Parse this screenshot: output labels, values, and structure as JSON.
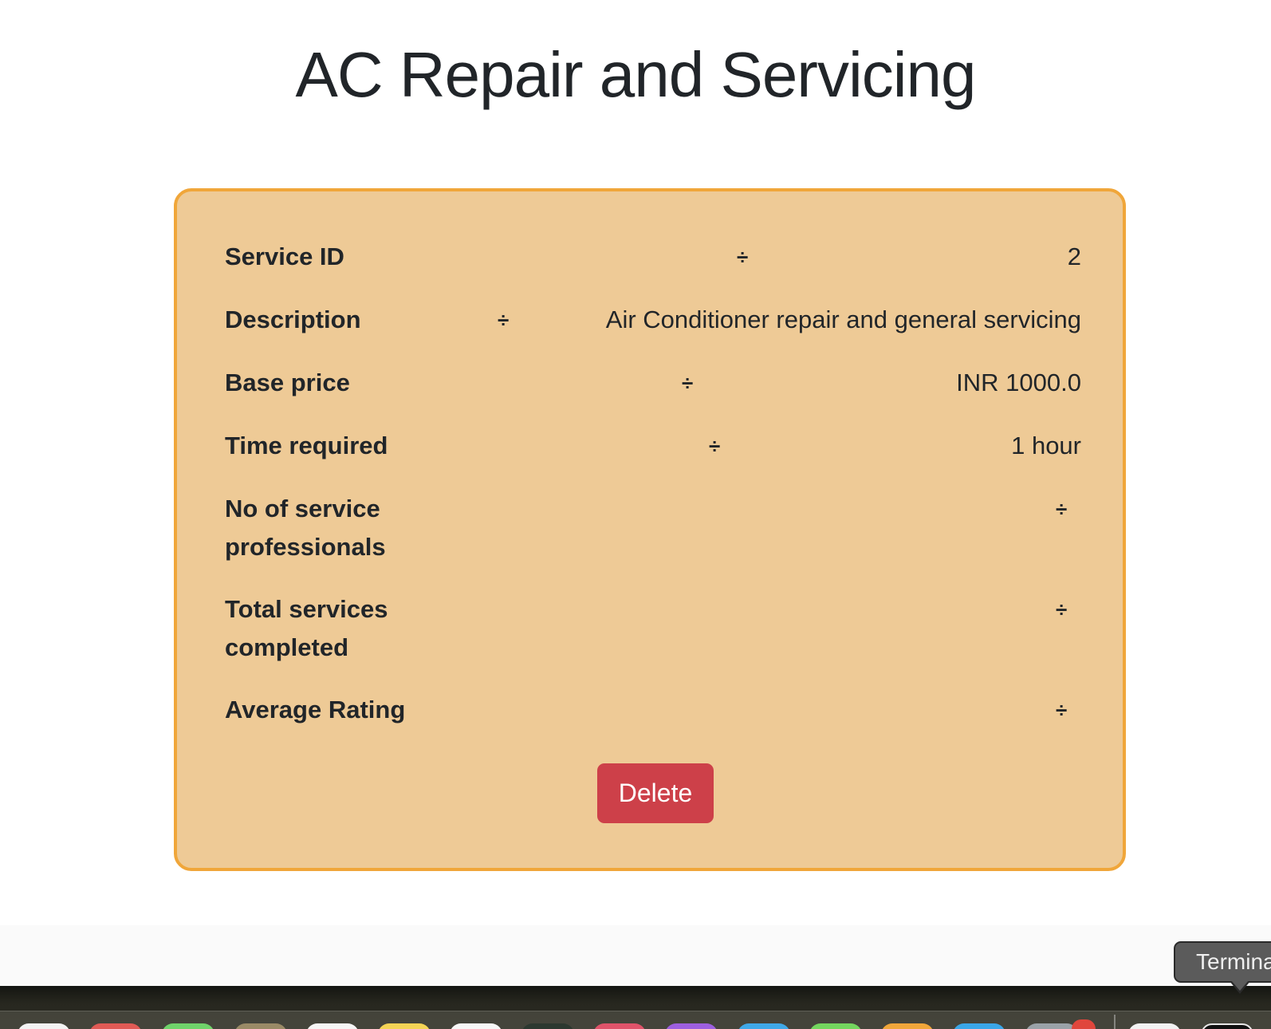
{
  "page": {
    "title": "AC Repair and Servicing"
  },
  "details": {
    "separator": "÷",
    "rows": [
      {
        "label": "Service ID",
        "value": "2"
      },
      {
        "label": "Description",
        "value": "Air Conditioner repair and general servicing"
      },
      {
        "label": "Base price",
        "value": "INR 1000.0"
      },
      {
        "label": "Time required",
        "value": "1 hour"
      },
      {
        "label": "No of service professionals",
        "value": ""
      },
      {
        "label": "Total services completed",
        "value": ""
      },
      {
        "label": "Average Rating",
        "value": ""
      }
    ]
  },
  "actions": {
    "delete_label": "Delete"
  },
  "dock": {
    "tooltip_label": "Terminal"
  },
  "colors": {
    "card_background": "#eeca96",
    "card_border": "#f0a63a",
    "delete_button": "#cd4049",
    "text": "#212529"
  }
}
